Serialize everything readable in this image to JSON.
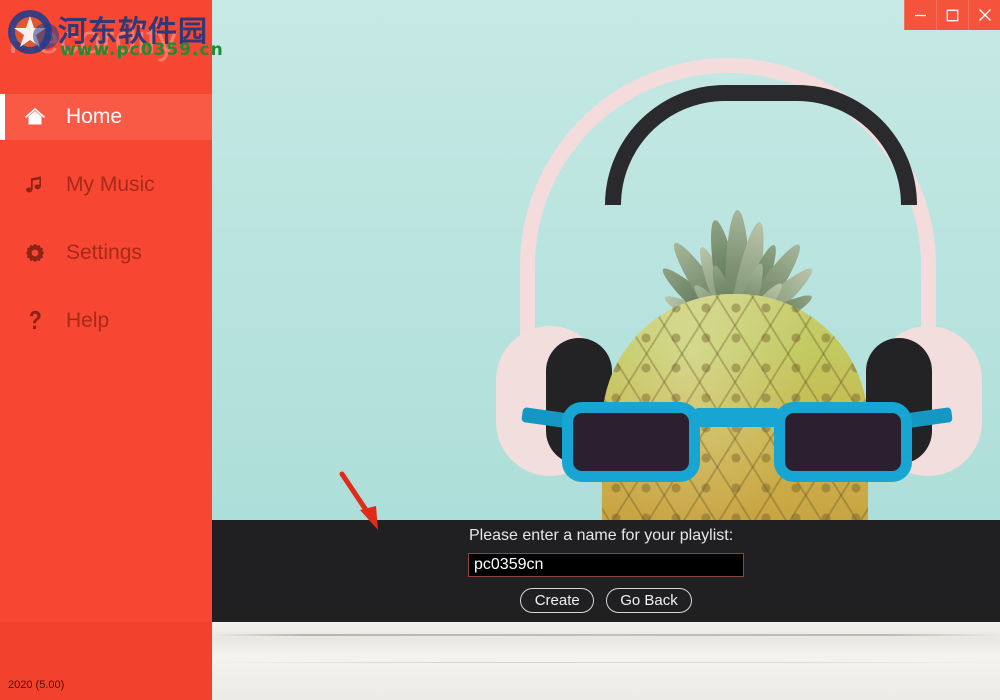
{
  "window": {
    "controls": [
      {
        "name": "minimize",
        "glyph": "minimize-icon",
        "label": "Minimize"
      },
      {
        "name": "maximize",
        "glyph": "maximize-icon",
        "label": "Maximize"
      },
      {
        "name": "close",
        "glyph": "close-icon",
        "label": "Close"
      }
    ],
    "titlebar_color": "#F4533C"
  },
  "sidebar": {
    "brand": "Recordify",
    "accent_color": "#F74733",
    "active_color": "#F85A45",
    "version": "2020 (5.00)",
    "items": [
      {
        "label": "Home",
        "icon": "home-icon",
        "active": true
      },
      {
        "label": "My Music",
        "icon": "music-note-icon",
        "active": false
      },
      {
        "label": "Settings",
        "icon": "gear-icon",
        "active": false
      },
      {
        "label": "Help",
        "icon": "question-mark-icon",
        "active": false
      }
    ]
  },
  "watermark": {
    "site_name_cn": "河东软件园",
    "site_url": "www.pc0359.cn",
    "cn_color": "#25377A",
    "url_color": "#1E8C34"
  },
  "hero": {
    "description": "pineapple-with-headphones-and-sunglasses-photo",
    "background_color": "#BFE6E2",
    "table_color": "#F0EEEA"
  },
  "prompt": {
    "label": "Please enter a name for your playlist:",
    "input_value": "pc0359cn",
    "input_placeholder": "",
    "panel_color": "#201F21",
    "input_border_color": "#8E4539",
    "buttons": [
      {
        "label": "Create",
        "name": "create-playlist-button"
      },
      {
        "label": "Go Back",
        "name": "go-back-button"
      }
    ]
  },
  "annotation": {
    "arrow_color": "#E02B18",
    "points_at": "Please enter a name for your playlist:"
  }
}
